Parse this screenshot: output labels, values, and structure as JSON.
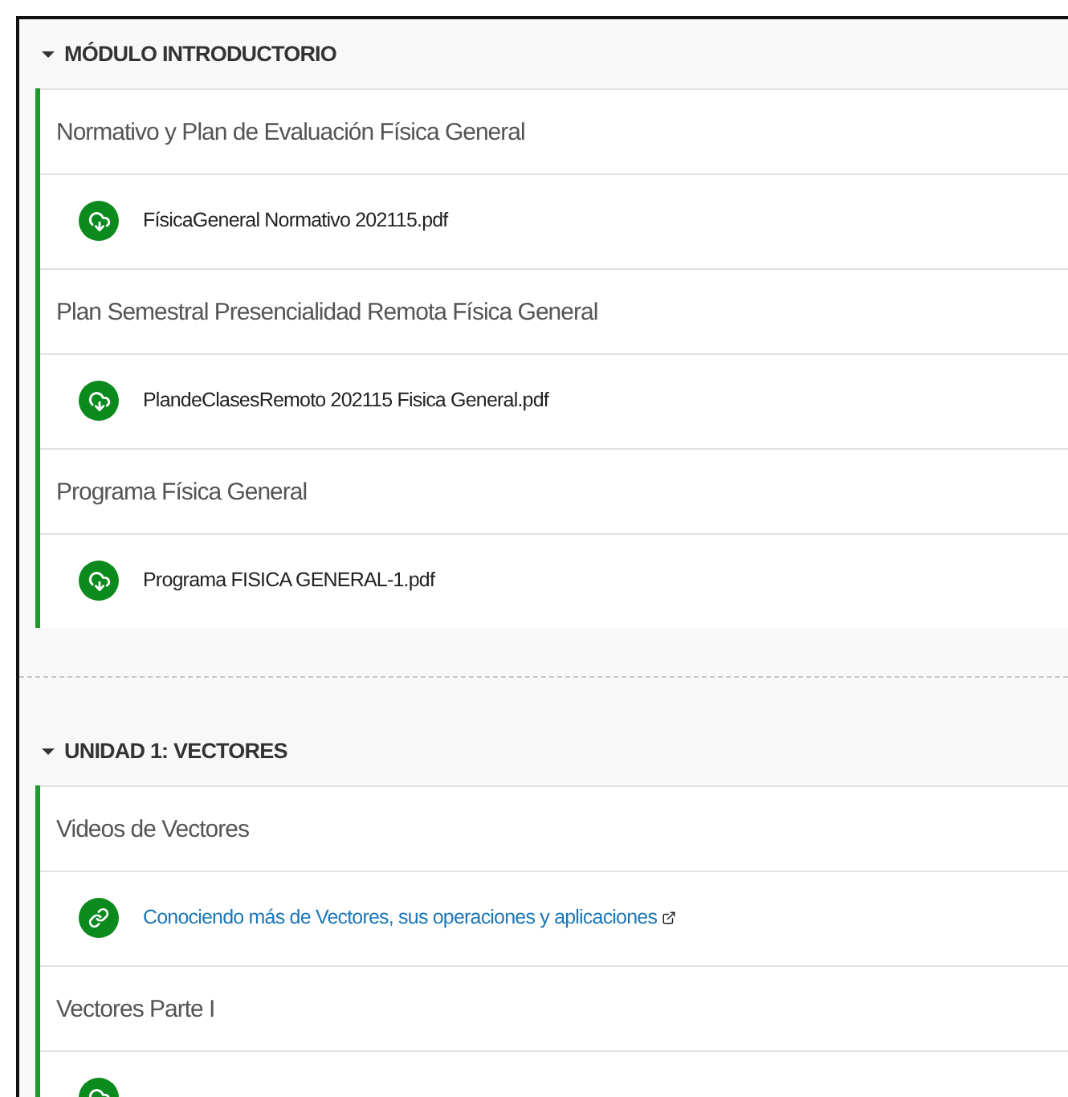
{
  "sections": [
    {
      "title": "MÓDULO INTRODUCTORIO",
      "expanded": true,
      "items": [
        {
          "kind": "label",
          "text": "Normativo y Plan de Evaluación Física General"
        },
        {
          "kind": "file",
          "text": "FísicaGeneral Normativo 202115.pdf"
        },
        {
          "kind": "label",
          "text": "Plan Semestral Presencialidad Remota Física General"
        },
        {
          "kind": "file",
          "text": "PlandeClasesRemoto 202115 Fisica General.pdf"
        },
        {
          "kind": "label",
          "text": "Programa Física General"
        },
        {
          "kind": "file",
          "text": "Programa FISICA GENERAL-1.pdf"
        }
      ]
    },
    {
      "title": "UNIDAD 1: VECTORES",
      "expanded": true,
      "items": [
        {
          "kind": "label",
          "text": "Videos de Vectores"
        },
        {
          "kind": "url",
          "text": "Conociendo más de Vectores, sus operaciones y aplicaciones"
        },
        {
          "kind": "label",
          "text": "Vectores Parte I"
        },
        {
          "kind": "file"
        }
      ]
    }
  ]
}
